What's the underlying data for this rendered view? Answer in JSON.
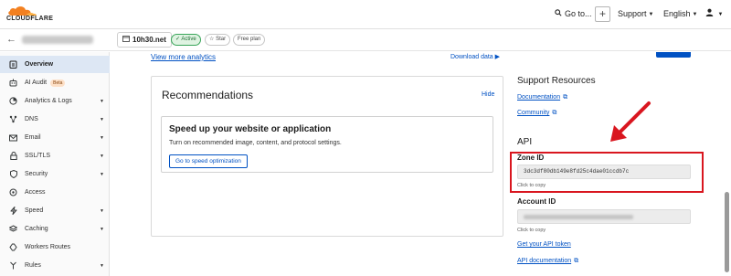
{
  "topbar": {
    "brand": "CLOUDFLARE",
    "goto_label": "Go to...",
    "plus_label": "+",
    "support_label": "Support",
    "language_label": "English"
  },
  "subheader": {
    "domain": "10h30.net",
    "status_badge": "Active",
    "star_label": "Star",
    "plan_label": "Free plan"
  },
  "sidebar": {
    "items": [
      {
        "label": "Overview",
        "icon": "clipboard-icon",
        "chevron": false
      },
      {
        "label": "AI Audit",
        "icon": "robot-icon",
        "chevron": false,
        "badge": "Beta"
      },
      {
        "label": "Analytics & Logs",
        "icon": "clock-chart-icon",
        "chevron": true
      },
      {
        "label": "DNS",
        "icon": "network-icon",
        "chevron": true
      },
      {
        "label": "Email",
        "icon": "envelope-icon",
        "chevron": true
      },
      {
        "label": "SSL/TLS",
        "icon": "lock-icon",
        "chevron": true
      },
      {
        "label": "Security",
        "icon": "shield-icon",
        "chevron": true
      },
      {
        "label": "Access",
        "icon": "access-icon",
        "chevron": false
      },
      {
        "label": "Speed",
        "icon": "lightning-icon",
        "chevron": true
      },
      {
        "label": "Caching",
        "icon": "stack-icon",
        "chevron": true
      },
      {
        "label": "Workers Routes",
        "icon": "workers-icon",
        "chevron": false
      },
      {
        "label": "Rules",
        "icon": "fork-icon",
        "chevron": true
      }
    ]
  },
  "main": {
    "more_analytics": "View more analytics",
    "download_data": "Download data",
    "recommendations": {
      "title": "Recommendations",
      "hide": "Hide",
      "card_title": "Speed up your website or application",
      "card_desc": "Turn on recommended image, content, and protocol settings.",
      "button": "Go to speed optimization"
    }
  },
  "right_panel": {
    "support_title": "Support Resources",
    "documentation": "Documentation",
    "community": "Community",
    "api_title": "API",
    "zone_id_label": "Zone ID",
    "zone_id_value": "3dc3df80db149e8fd25c4dae01ccdb7c",
    "click_to_copy": "Click to copy",
    "account_id_label": "Account ID",
    "get_api_token": "Get your API token",
    "api_documentation": "API documentation"
  },
  "colors": {
    "link": "#0051c3",
    "highlight": "#d9161f",
    "active_badge": "#3aa65a",
    "sidebar_active": "#dde7f4",
    "brand_orange": "#f38020"
  }
}
